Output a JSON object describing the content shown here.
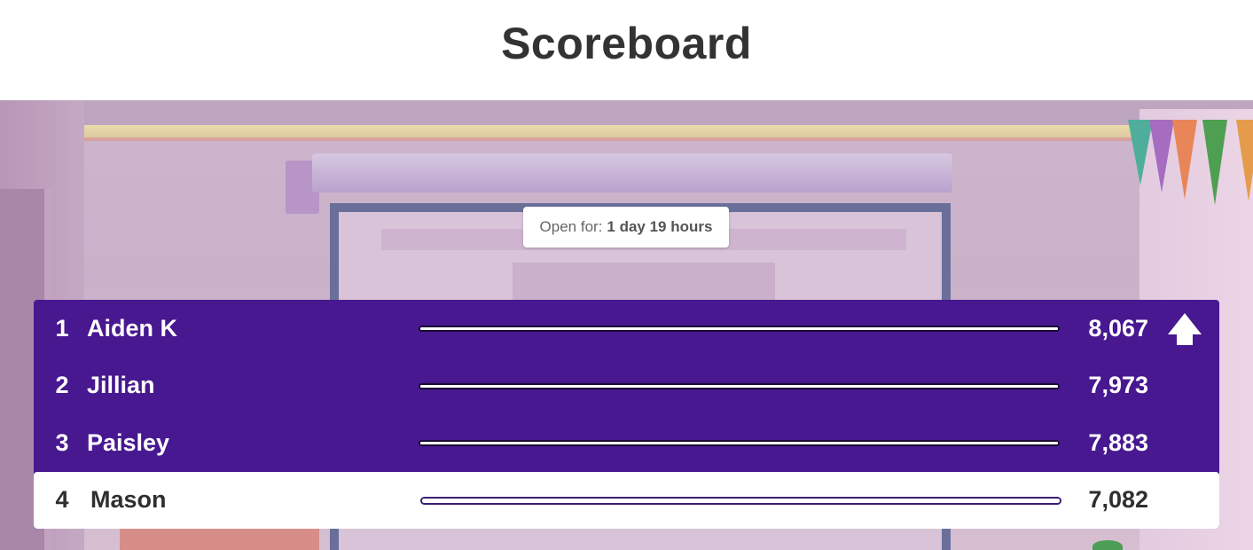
{
  "header": {
    "title": "Scoreboard"
  },
  "timer": {
    "label": "Open for:",
    "value": "1 day 19 hours"
  },
  "scoreboard": {
    "scroll_icon": "arrow-up-icon",
    "colors": {
      "panel": "#471890",
      "highlight_row": "#ffffff",
      "text_light": "#ffffff",
      "text_dark": "#2f2f2f"
    },
    "rows": [
      {
        "rank": "1",
        "name": "Aiden K",
        "score": "8,067",
        "progress": 1.0
      },
      {
        "rank": "2",
        "name": "Jillian",
        "score": "7,973",
        "progress": 1.0
      },
      {
        "rank": "3",
        "name": "Paisley",
        "score": "7,883",
        "progress": 1.0
      },
      {
        "rank": "4",
        "name": "Mason",
        "score": "7,082",
        "progress": 1.0,
        "highlighted": true
      }
    ]
  }
}
